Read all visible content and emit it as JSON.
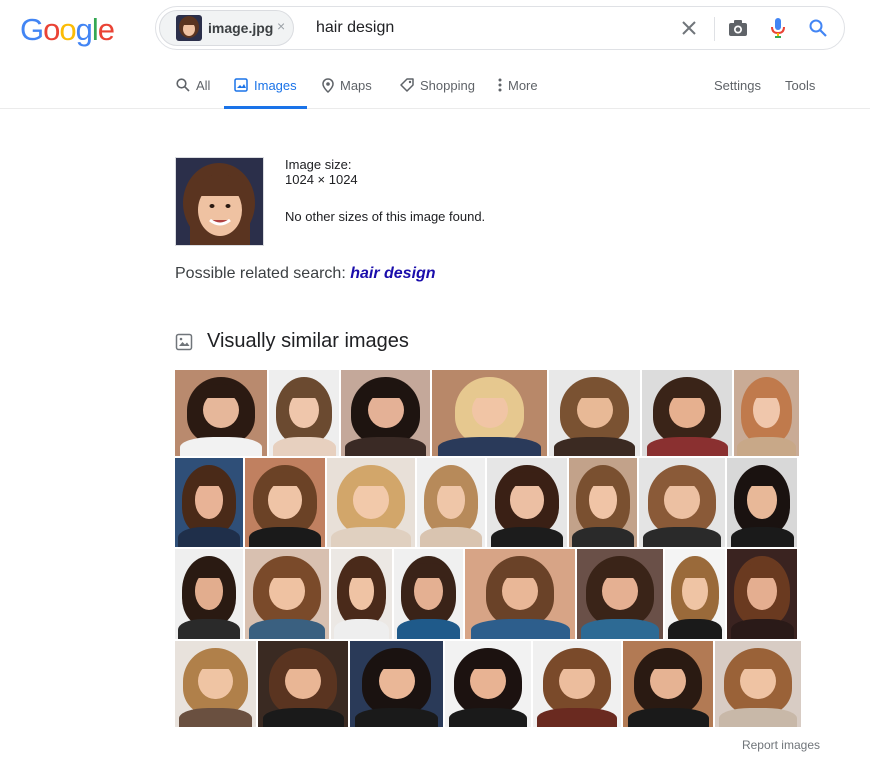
{
  "logo": {
    "letters": [
      "G",
      "o",
      "o",
      "g",
      "l",
      "e"
    ],
    "colors": [
      "#4285f4",
      "#ea4335",
      "#fbbc05",
      "#4285f4",
      "#34a853",
      "#ea4335"
    ]
  },
  "search": {
    "chip_label": "image.jpg",
    "chip_close": "×",
    "query": "hair design"
  },
  "tabs": [
    {
      "label": "All",
      "icon": "search-icon"
    },
    {
      "label": "Images",
      "icon": "image-icon",
      "active": true
    },
    {
      "label": "Maps",
      "icon": "map-pin-icon"
    },
    {
      "label": "Shopping",
      "icon": "tag-icon"
    },
    {
      "label": "More",
      "icon": "more-vert-icon"
    }
  ],
  "right_tabs": {
    "settings": "Settings",
    "tools": "Tools"
  },
  "result": {
    "size_label": "Image size:",
    "size_value": "1024 × 1024",
    "no_sizes": "No other sizes of this image found.",
    "related_prefix": "Possible related search:",
    "related_link": "hair design"
  },
  "similar": {
    "heading": "Visually similar images",
    "rows": [
      [
        {
          "w": 92,
          "bg": "#b98a6e",
          "hair": "#2b1a12",
          "skin": "#e6b79a",
          "shirt": "#f2f2f2"
        },
        {
          "w": 70,
          "bg": "#eeeeee",
          "hair": "#6b4a30",
          "skin": "#efc6ab",
          "shirt": "#e7d0bf"
        },
        {
          "w": 89,
          "bg": "#c4a89a",
          "hair": "#1e1410",
          "skin": "#e4b196",
          "shirt": "#3a2a25"
        },
        {
          "w": 115,
          "bg": "#b88869",
          "hair": "#e6c88f",
          "skin": "#f1c5a5",
          "shirt": "#2a3a5a"
        },
        {
          "w": 91,
          "bg": "#e8e8e8",
          "hair": "#7a5232",
          "skin": "#e8b996",
          "shirt": "#3b2a22"
        },
        {
          "w": 90,
          "bg": "#dcdcdc",
          "hair": "#3a2418",
          "skin": "#e6b08f",
          "shirt": "#8a3030"
        },
        {
          "w": 65,
          "bg": "#c9ab96",
          "hair": "#c07a4c",
          "skin": "#f0c7ac",
          "shirt": "#c8a888"
        }
      ],
      [
        {
          "w": 68,
          "bg": "#2f4f78",
          "hair": "#4a2a18",
          "skin": "#e8b396",
          "shirt": "#1f2f4a"
        },
        {
          "w": 80,
          "bg": "#c08060",
          "hair": "#6b4226",
          "skin": "#efc4a6",
          "shirt": "#1a1a1a"
        },
        {
          "w": 88,
          "bg": "#e8e0d8",
          "hair": "#d2a66a",
          "skin": "#f2c9aa",
          "shirt": "#e0d0c0"
        },
        {
          "w": 68,
          "bg": "#efefef",
          "hair": "#b78a5a",
          "skin": "#efc6a8",
          "shirt": "#d9c4b0"
        },
        {
          "w": 80,
          "bg": "#e6e6e6",
          "hair": "#3a2015",
          "skin": "#ecbfa3",
          "shirt": "#1c1c1c"
        },
        {
          "w": 68,
          "bg": "#c2a28a",
          "hair": "#7a5030",
          "skin": "#f0c4a6",
          "shirt": "#2a2a2a"
        },
        {
          "w": 86,
          "bg": "#e4e4e4",
          "hair": "#8a5a38",
          "skin": "#ecc0a2",
          "shirt": "#2a2a2a"
        },
        {
          "w": 70,
          "bg": "#d8d8d8",
          "hair": "#1a1210",
          "skin": "#e8b898",
          "shirt": "#1a1a1a"
        }
      ],
      [
        {
          "w": 68,
          "bg": "#efefef",
          "hair": "#2a1a12",
          "skin": "#e2ad8e",
          "shirt": "#2a2a2a"
        },
        {
          "w": 84,
          "bg": "#d8c0b0",
          "hair": "#7a4a2a",
          "skin": "#efc2a2",
          "shirt": "#3a6080"
        },
        {
          "w": 61,
          "bg": "#ece8e4",
          "hair": "#4a2a1a",
          "skin": "#efc3a4",
          "shirt": "#eeeeee"
        },
        {
          "w": 69,
          "bg": "#f0f0f0",
          "hair": "#3a2318",
          "skin": "#e4b092",
          "shirt": "#1f5a8a"
        },
        {
          "w": 110,
          "bg": "#d7a486",
          "hair": "#6a4228",
          "skin": "#e9b797",
          "shirt": "#2d5e8c"
        },
        {
          "w": 86,
          "bg": "#6a5048",
          "hair": "#3a2418",
          "skin": "#e5b092",
          "shirt": "#2d6a94"
        },
        {
          "w": 60,
          "bg": "#f4f4f4",
          "hair": "#9a6a3a",
          "skin": "#efc4a4",
          "shirt": "#1a1a1a"
        },
        {
          "w": 70,
          "bg": "#3a2320",
          "hair": "#6a3a20",
          "skin": "#e4ae90",
          "shirt": "#2a1a18"
        }
      ],
      [
        {
          "w": 81,
          "bg": "#e8e2dc",
          "hair": "#b0804a",
          "skin": "#efc4a3",
          "shirt": "#6a5040"
        },
        {
          "w": 90,
          "bg": "#3a2a22",
          "hair": "#5a3420",
          "skin": "#e9b695",
          "shirt": "#1a1a1a"
        },
        {
          "w": 93,
          "bg": "#2a3a58",
          "hair": "#1a1210",
          "skin": "#eab797",
          "shirt": "#1a1a1a"
        },
        {
          "w": 86,
          "bg": "#f2f2f2",
          "hair": "#1c1210",
          "skin": "#e8b393",
          "shirt": "#1a1a1a"
        },
        {
          "w": 88,
          "bg": "#f0f0f0",
          "hair": "#7a4a2a",
          "skin": "#ecbd9d",
          "shirt": "#6a2a20"
        },
        {
          "w": 90,
          "bg": "#b27a54",
          "hair": "#2a1a12",
          "skin": "#e6b393",
          "shirt": "#1a1a1a"
        },
        {
          "w": 86,
          "bg": "#d8ccc4",
          "hair": "#9a6238",
          "skin": "#efc3a3",
          "shirt": "#c8b8a8"
        }
      ]
    ]
  },
  "footer": {
    "report": "Report images"
  }
}
